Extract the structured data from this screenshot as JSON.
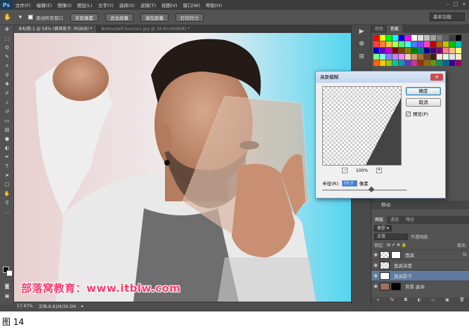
{
  "menubar": {
    "logo": "Ps",
    "items": [
      "文件(F)",
      "编辑(E)",
      "图像(I)",
      "图层(L)",
      "文字(Y)",
      "选择(S)",
      "滤镜(T)",
      "视图(V)",
      "窗口(W)",
      "帮助(H)"
    ],
    "controls": [
      "–",
      "□",
      "×"
    ]
  },
  "options": {
    "scroll_all_label": "滚动所有窗口",
    "buttons": [
      "实际像素",
      "适合屏幕",
      "填充屏幕",
      "打印尺寸"
    ],
    "workspace": "基本功能"
  },
  "tabs": [
    {
      "label": "未标题-1 @ 58% (面具影子, RGB/8) *",
      "active": true
    },
    {
      "label": "BeYourself-Source1.jpg @ 39.6%(RGB/8) *",
      "active": false
    }
  ],
  "status": {
    "zoom": "57.97%",
    "doc": "文档:8.81M/39.5M"
  },
  "panels": {
    "swatch_tabs": [
      "颜色",
      "色板"
    ],
    "swatch_colors": [
      "#ff0000",
      "#ffff00",
      "#00ff00",
      "#00ffff",
      "#0000ff",
      "#ff00ff",
      "#ffffff",
      "#e0e0e0",
      "#c0c0c0",
      "#a0a0a0",
      "#808080",
      "#606060",
      "#404040",
      "#000000",
      "#ff4040",
      "#ff8040",
      "#ffc040",
      "#c0ff40",
      "#40ff80",
      "#40ffff",
      "#4080ff",
      "#8040ff",
      "#ff40c0",
      "#c00000",
      "#c06000",
      "#c0c000",
      "#00c000",
      "#00c0c0",
      "#0000c0",
      "#6000c0",
      "#c000c0",
      "#800000",
      "#804000",
      "#808000",
      "#008000",
      "#008080",
      "#000080",
      "#400080",
      "#800080",
      "#ff8080",
      "#ffc080",
      "#ffff80",
      "#80ff80",
      "#80ffff",
      "#8080ff",
      "#c080ff",
      "#ff80ff",
      "#f0d0b0",
      "#d0a070",
      "#a07040",
      "#704020",
      "#402010",
      "#ffe0e0",
      "#e0ffe0",
      "#e0e0ff",
      "#fff0c0",
      "#ff6600",
      "#ffcc00",
      "#99cc00",
      "#00cc99",
      "#0099cc",
      "#6633cc",
      "#cc3399",
      "#993300",
      "#996600",
      "#669900",
      "#009966",
      "#006699",
      "#330099",
      "#990066"
    ],
    "history_item": "移动",
    "layer_tabs": [
      "图层",
      "通道",
      "路径"
    ],
    "kind_label": "类型",
    "blend_mode": "正常",
    "opacity_label": "不透明度:",
    "lock_label": "锁定:",
    "fill_label": "填充:",
    "layers": [
      {
        "name": "面具",
        "selected": false,
        "fx": "fx"
      },
      {
        "name": "面具深度",
        "selected": false,
        "fx": ""
      },
      {
        "name": "面具影子",
        "selected": true,
        "fx": ""
      },
      {
        "name": "背景 副本",
        "selected": false,
        "fx": ""
      }
    ],
    "layer_bottom_icons": [
      "∞",
      "fx",
      "◘",
      "◐",
      "▭",
      "▣",
      "🗑"
    ]
  },
  "dialog": {
    "title": "高斯模糊",
    "ok": "确定",
    "cancel": "取消",
    "preview_label": "预览(P)",
    "zoom": "100%",
    "radius_label": "半径(R):",
    "radius_value": "50.0",
    "unit": "像素",
    "slider_fraction": 0.58
  },
  "watermark": "部落窝教育：www.itblw.com",
  "caption": "图 14",
  "colors": {
    "accent": "#3b7fd8",
    "selected_layer": "#5f7a9c",
    "watermark": "#ff3b6e"
  }
}
